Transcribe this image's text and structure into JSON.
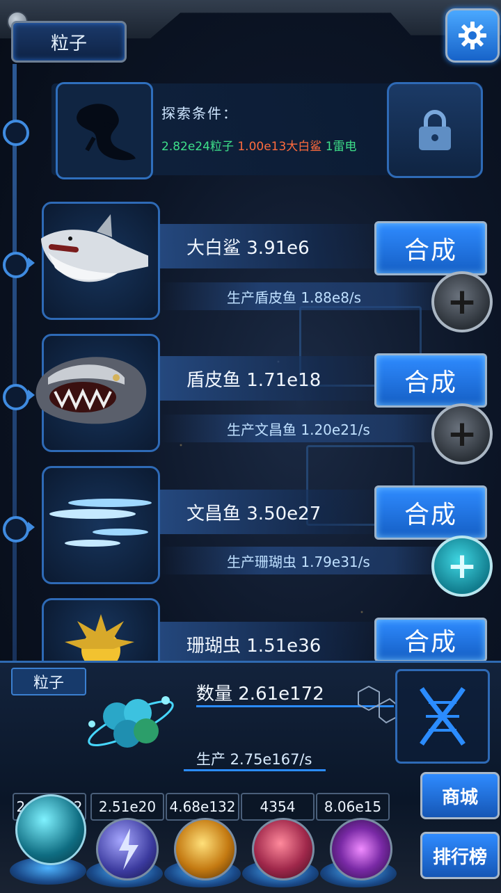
{
  "header": {
    "title": "粒子"
  },
  "explore": {
    "title": "探索条件：",
    "req1": "2.82e24粒子",
    "req2": "1.00e13大白鲨",
    "req3": "1雷电",
    "colors": {
      "req1": "#3ee08a",
      "req2": "#ff6b3d",
      "req3": "#3ee08a"
    }
  },
  "creatures": [
    {
      "name_line": "大白鲨 3.91e6",
      "prod_line": "生产盾皮鱼 1.88e8/s",
      "button": "合成"
    },
    {
      "name_line": "盾皮鱼 1.71e18",
      "prod_line": "生产文昌鱼 1.20e21/s",
      "button": "合成"
    },
    {
      "name_line": "文昌鱼 3.50e27",
      "prod_line": "生产珊瑚虫 1.79e31/s",
      "button": "合成"
    },
    {
      "name_line": "珊瑚虫 1.51e36",
      "button": "合成"
    }
  ],
  "resource": {
    "tag": "粒子",
    "count": "数量 2.61e172",
    "production": "生产 2.75e167/s"
  },
  "counters": [
    "2.61e172",
    "2.51e20",
    "4.68e132",
    "4354",
    "8.06e15"
  ],
  "side_buttons": {
    "shop": "商城",
    "rank": "排行榜"
  },
  "accent_color": "#2b8cff"
}
